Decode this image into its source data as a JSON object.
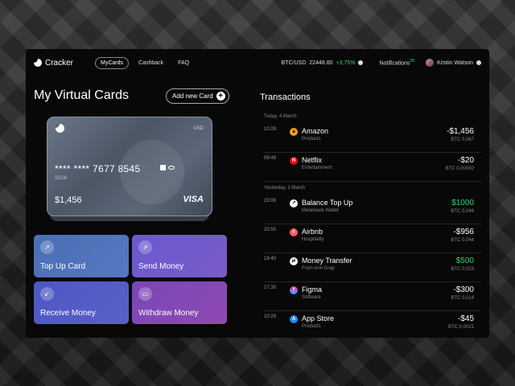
{
  "header": {
    "brand": "Cracker",
    "nav": [
      "MyCards",
      "Cashback",
      "FAQ"
    ],
    "btc_label": "BTC/USD",
    "btc_price": "22448.80",
    "btc_change": "+3,75%",
    "notifications_label": "Notifications",
    "notifications_count": "25",
    "user_name": "Kristin Watson"
  },
  "left": {
    "title": "My Virtual Cards",
    "add_card_label": "Add new Card",
    "card": {
      "currency": "USD",
      "number": "**** **** 7677 8545",
      "expiry": "05/26",
      "balance": "$1,456",
      "brand": "VISA"
    },
    "actions": [
      {
        "label": "Top Up Card",
        "icon": "trend-up-icon"
      },
      {
        "label": "Send Money",
        "icon": "external-link-icon"
      },
      {
        "label": "Receive Money",
        "icon": "arrow-down-left-icon"
      },
      {
        "label": "Withdraw Money",
        "icon": "wallet-icon"
      }
    ]
  },
  "transactions": {
    "title": "Transactions",
    "groups": [
      {
        "date": "Today, 4 March",
        "items": [
          {
            "time": "10:29",
            "name": "Amazon",
            "category": "Products",
            "amount": "-$1,456",
            "btc": "BTC 0,067",
            "positive": false,
            "icon": "amazon-icon"
          },
          {
            "time": "09:49",
            "name": "Netflix",
            "category": "Entertainment",
            "amount": "-$20",
            "btc": "BTC 0,00092",
            "positive": false,
            "icon": "netflix-icon"
          }
        ]
      },
      {
        "date": "Yesterday, 3 March",
        "items": [
          {
            "time": "23:08",
            "name": "Balance Top Up",
            "category": "Metamask Wallet",
            "amount": "$1000",
            "btc": "BTC 0,046",
            "positive": true,
            "icon": "trend-up-icon"
          },
          {
            "time": "20:50",
            "name": "Airbnb",
            "category": "Hospitality",
            "amount": "-$956",
            "btc": "BTC 0,044",
            "positive": false,
            "icon": "airbnb-icon"
          },
          {
            "time": "18:40",
            "name": "Money Transfer",
            "category": "From Ann Gray",
            "amount": "$500",
            "btc": "BTC 0,023",
            "positive": true,
            "icon": "transfer-icon"
          },
          {
            "time": "17:30",
            "name": "Figma",
            "category": "Software",
            "amount": "-$300",
            "btc": "BTC 0,014",
            "positive": false,
            "icon": "figma-icon"
          },
          {
            "time": "10:29",
            "name": "App Store",
            "category": "Products",
            "amount": "-$45",
            "btc": "BTC 0,0021",
            "positive": false,
            "icon": "app-store-icon"
          }
        ]
      }
    ]
  },
  "colors": {
    "positive": "#3ad17a",
    "app_bg": "#080808"
  }
}
